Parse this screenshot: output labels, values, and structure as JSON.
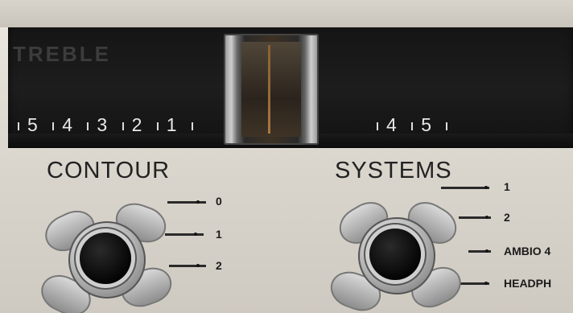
{
  "dial": {
    "treble_label": "TREBLE",
    "left_scale": [
      "5",
      "4",
      "3",
      "2",
      "1"
    ],
    "right_scale": [
      "4",
      "5"
    ]
  },
  "contour": {
    "label": "CONTOUR",
    "positions": [
      "0",
      "1",
      "2"
    ]
  },
  "systems": {
    "label": "SYSTEMS",
    "positions": [
      "1",
      "2",
      "AMBIO 4",
      "HEADPH"
    ]
  }
}
